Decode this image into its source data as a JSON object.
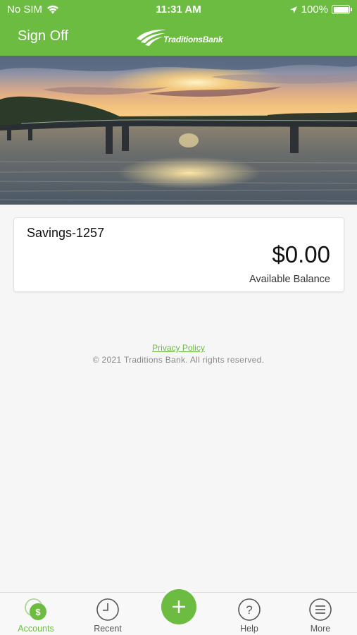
{
  "status_bar": {
    "carrier": "No SIM",
    "time": "11:31 AM",
    "battery": "100%"
  },
  "header": {
    "sign_off_label": "Sign Off",
    "logo_text": "TraditionsBank"
  },
  "account": {
    "name": "Savings-1257",
    "balance": "$0.00",
    "balance_label": "Available Balance"
  },
  "footer": {
    "privacy_label": "Privacy Policy",
    "copyright": "© 2021 Traditions Bank. All rights reserved."
  },
  "tab_bar": {
    "tabs": [
      {
        "label": "Accounts",
        "icon": "accounts-dollar-icon",
        "active": true
      },
      {
        "label": "Recent",
        "icon": "clock-icon",
        "active": false
      },
      {
        "label": "",
        "icon": "plus-icon",
        "active": false
      },
      {
        "label": "Help",
        "icon": "help-question-icon",
        "active": false
      },
      {
        "label": "More",
        "icon": "menu-icon",
        "active": false
      }
    ]
  },
  "colors": {
    "brand_green": "#6cbc41",
    "background": "#f6f6f6"
  }
}
